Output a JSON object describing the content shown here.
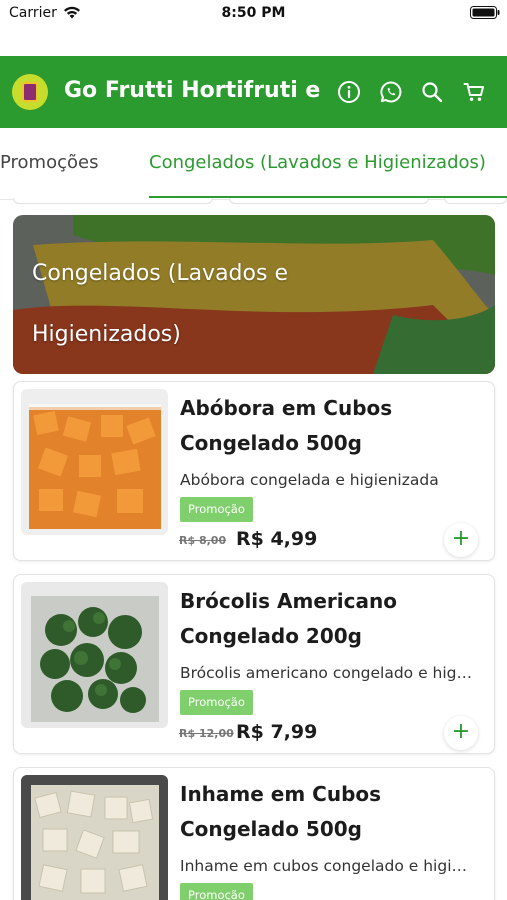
{
  "status_bar": {
    "carrier": "Carrier",
    "time": "8:50 PM"
  },
  "header": {
    "title": "Go Frutti Hortifruti e",
    "icons": [
      "info-icon",
      "whatsapp-icon",
      "search-icon",
      "cart-icon"
    ],
    "color": "#2b9a2f"
  },
  "tabs": [
    {
      "label": "Promoções",
      "active": false
    },
    {
      "label": "Congelados (Lavados e Higienizados)",
      "active": true
    }
  ],
  "category": {
    "title": "Congelados (Lavados e Higienizados)"
  },
  "products": [
    {
      "name": "Abóbora em Cubos Congelado 500g",
      "description": "Abóbora congelada e higienizada",
      "badge": "Promoção",
      "old_price": "R$ 8,00",
      "price": "R$ 4,99",
      "add_label": "+"
    },
    {
      "name": "Brócolis Americano Congelado 200g",
      "description": "Brócolis americano congelado e higienizado",
      "badge": "Promoção",
      "old_price": "R$ 12,00",
      "price": "R$ 7,99",
      "add_label": "+"
    },
    {
      "name": "Inhame em Cubos Congelado 500g",
      "description": "Inhame em cubos congelado e higienizado",
      "badge": "Promoção"
    }
  ],
  "colors": {
    "accent": "#2b9a2f",
    "badge": "#7fd06c"
  }
}
